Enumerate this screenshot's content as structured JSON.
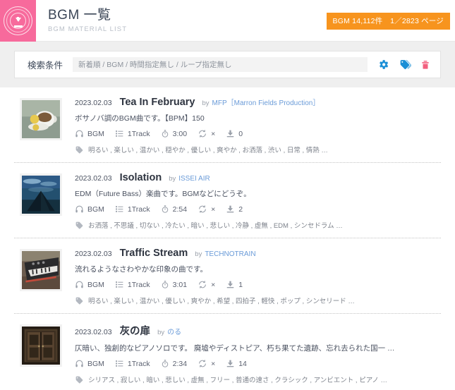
{
  "header": {
    "logo_icon": "download-seal-logo",
    "title": "BGM 一覧",
    "subtitle": "BGM MATERIAL LIST",
    "count_badge": "BGM 14,112件　1／2823 ページ",
    "badge_color": "#f7941e",
    "brand_color": "#f76a9c"
  },
  "search": {
    "label": "検索条件",
    "value": "新着順 / BGM / 時間指定無し / ループ指定無し",
    "icons": [
      {
        "name": "gear-icon",
        "color": "#1b8fd6"
      },
      {
        "name": "tag-icon",
        "color": "#1b8fd6"
      },
      {
        "name": "trash-icon",
        "color": "#f2607f"
      }
    ]
  },
  "meta_labels": {
    "category_icon": "headphones-icon",
    "track_icon": "tracklist-icon",
    "time_icon": "stopwatch-icon",
    "loop_icon": "loop-icon",
    "download_icon": "download-icon",
    "tag_icon": "tag-icon"
  },
  "list": [
    {
      "date": "2023.02.03",
      "title": "Tea In February",
      "by": "by",
      "artist": "MFP［Marron Fields Production］",
      "description": "ボサノバ調のBGM曲です。【BPM】150",
      "category": "BGM",
      "tracks": "1Track",
      "duration": "3:00",
      "loop": "×",
      "downloads": "0",
      "tags": "明るい , 楽しい , 温かい , 穏やか , 優しい , 爽やか , お洒落 , 渋い , 日常 , 情熱 …",
      "thumbnail": "teacup-photo"
    },
    {
      "date": "2023.02.03",
      "title": "Isolation",
      "by": "by",
      "artist": "ISSEI AIR",
      "description": "EDM（Future Bass）楽曲です。BGMなどにどうぞ。",
      "category": "BGM",
      "tracks": "1Track",
      "duration": "2:54",
      "loop": "×",
      "downloads": "2",
      "tags": "お洒落 , 不思議 , 切ない , 冷たい , 暗い , 悲しい , 冷静 , 虚無 , EDM , シンセドラム …",
      "thumbnail": "pyramid-night-photo"
    },
    {
      "date": "2023.02.03",
      "title": "Traffic Stream",
      "by": "by",
      "artist": "TECHNOTRAIN",
      "description": "流れるようなさわやかな印象の曲です。",
      "category": "BGM",
      "tracks": "1Track",
      "duration": "3:01",
      "loop": "×",
      "downloads": "1",
      "tags": "明るい , 楽しい , 温かい , 優しい , 爽やか , 希望 , 四拍子 , 軽快 , ポップ , シンセリード …",
      "thumbnail": "synthesizer-photo"
    },
    {
      "date": "2023.02.03",
      "title": "灰の扉",
      "by": "by",
      "artist": "のる",
      "description": "仄暗い、独創的なピアノソロです。 廃墟やディストピア、朽ち果てた遺跡、忘れ去られた国一 …",
      "category": "BGM",
      "tracks": "1Track",
      "duration": "2:34",
      "loop": "×",
      "downloads": "14",
      "tags": "シリアス , 寂しい , 暗い , 悲しい , 虚無 , フリー , 普通の速さ , クラシック , アンビエント , ピアノ …",
      "thumbnail": "dark-door-photo"
    }
  ]
}
